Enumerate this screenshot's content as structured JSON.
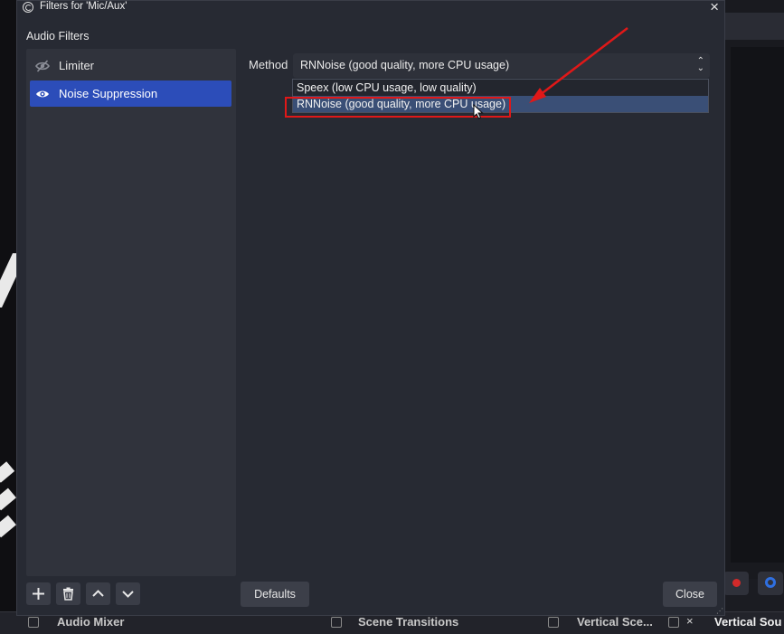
{
  "window": {
    "title": "Filters for 'Mic/Aux'",
    "close_glyph": "×"
  },
  "filters": {
    "section_label": "Audio Filters",
    "items": [
      {
        "label": "Limiter",
        "enabled": false,
        "icon": "eye-hidden-icon"
      },
      {
        "label": "Noise Suppression",
        "enabled": true,
        "icon": "eye-icon",
        "selected": true
      }
    ]
  },
  "settings": {
    "method_label": "Method",
    "method_value": "RNNoise (good quality, more CPU usage)",
    "options": [
      "Speex (low CPU usage, low quality)",
      "RNNoise (good quality, more CPU usage)"
    ],
    "highlighted_option_index": 1
  },
  "buttons": {
    "defaults": "Defaults",
    "close": "Close"
  },
  "toolbar_icons": [
    "add-icon",
    "trash-icon",
    "move-up-icon",
    "move-down-icon"
  ],
  "background": {
    "docks": [
      "Audio Mixer",
      "Scene Transitions",
      "Vertical Sce...",
      "Vertical Sou"
    ]
  },
  "colors": {
    "selection": "#2c4db9",
    "annotation_red": "#e01818",
    "dialog_bg": "#272a33"
  }
}
